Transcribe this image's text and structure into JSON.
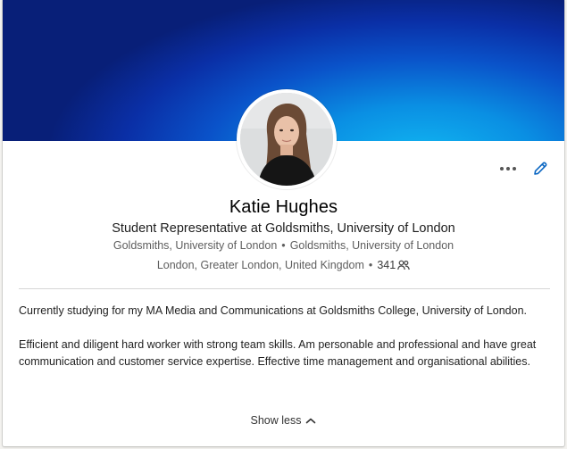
{
  "profile": {
    "name": "Katie Hughes",
    "headline": "Student Representative at Goldsmiths, University of London",
    "experience_org": "Goldsmiths, University of London",
    "education_org": "Goldsmiths, University of London",
    "location": "London, Greater London, United Kingdom",
    "connections": "341",
    "separator": "•"
  },
  "about": {
    "paragraphs": [
      "Currently studying for my MA Media and Communications at Goldsmiths College, University of London.",
      "Efficient and diligent hard worker with strong team skills. Am personable and professional and have great communication and customer service expertise. Effective time management and organisational abilities."
    ],
    "toggle_label": "Show less"
  },
  "icons": {
    "more": "more-horizontal-icon",
    "edit": "pencil-icon",
    "connections": "people-icon",
    "toggle": "chevron-up-icon"
  },
  "colors": {
    "accent": "#0a66c2",
    "banner_dark": "#081f78",
    "banner_light": "#11b6f1"
  }
}
